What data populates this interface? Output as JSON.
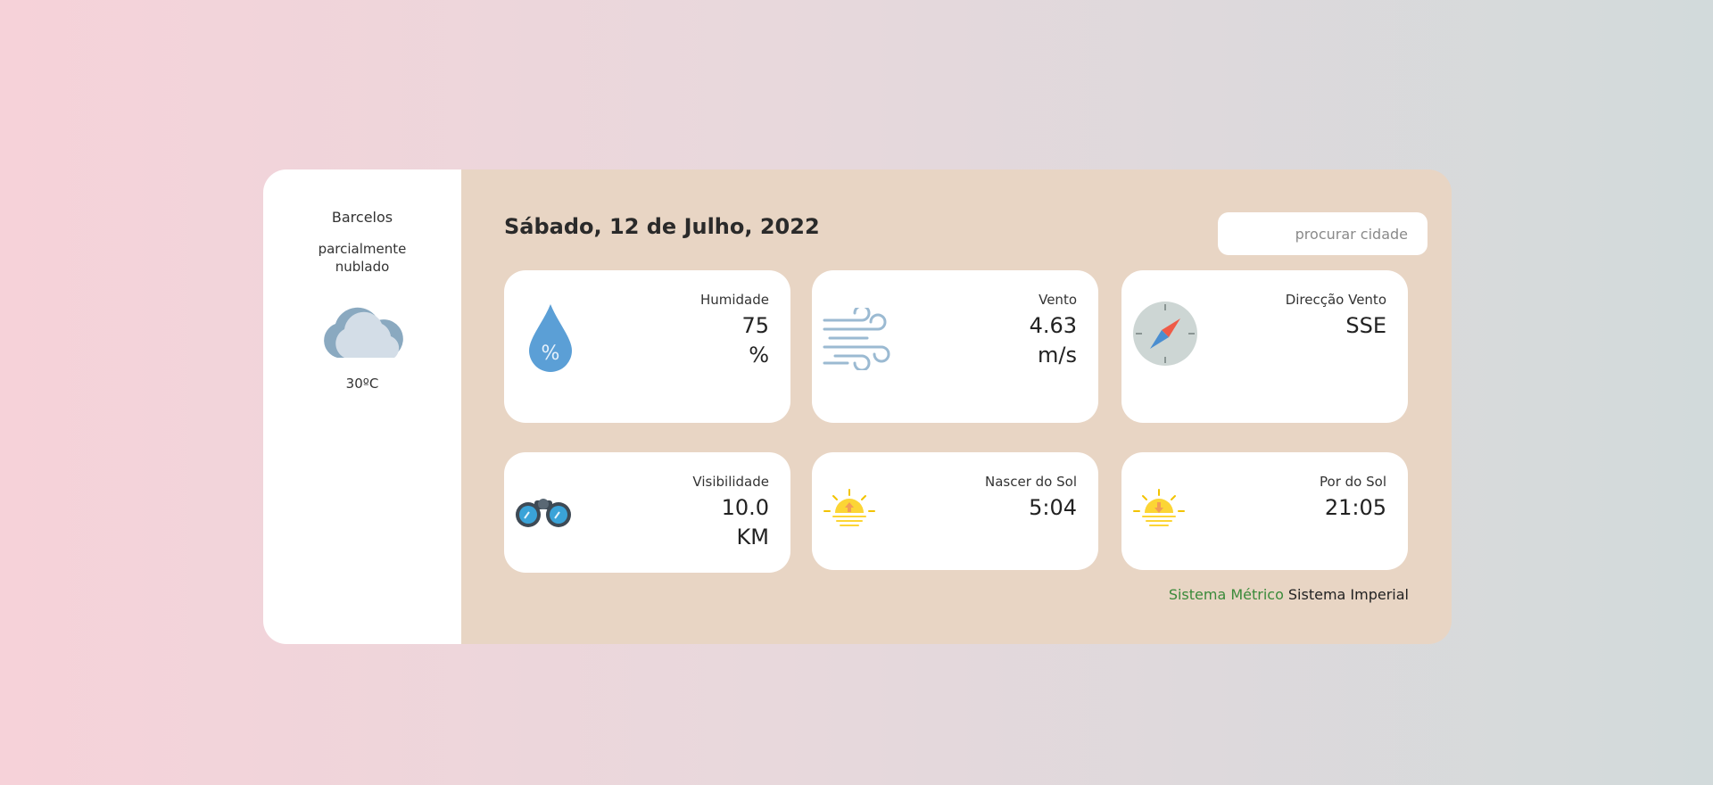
{
  "sidebar": {
    "city": "Barcelos",
    "condition": "parcialmente nublado",
    "weather_icon": "partly-cloudy-icon",
    "temperature": "30ºC"
  },
  "header": {
    "date": "Sábado, 12 de Julho, 2022",
    "search_placeholder": "procurar cidade"
  },
  "cards": [
    {
      "label": "Humidade",
      "value": "75",
      "unit": "%",
      "icon": "humidity-drop-icon"
    },
    {
      "label": "Vento",
      "value": "4.63",
      "unit": "m/s",
      "icon": "wind-icon"
    },
    {
      "label": "Direcção Vento",
      "value": "SSE",
      "icon": "compass-icon"
    },
    {
      "label": "Visibilidade",
      "value": "10.0",
      "unit": "KM",
      "icon": "binoculars-icon"
    },
    {
      "label": "Nascer do Sol",
      "value": "5:04",
      "icon": "sunrise-icon"
    },
    {
      "label": "Por do Sol",
      "value": "21:05",
      "icon": "sunset-icon"
    }
  ],
  "units": {
    "metric_label": "Sistema Métrico",
    "imperial_label": "Sistema Imperial",
    "active": "metric",
    "active_color": "#3a8a3a"
  }
}
